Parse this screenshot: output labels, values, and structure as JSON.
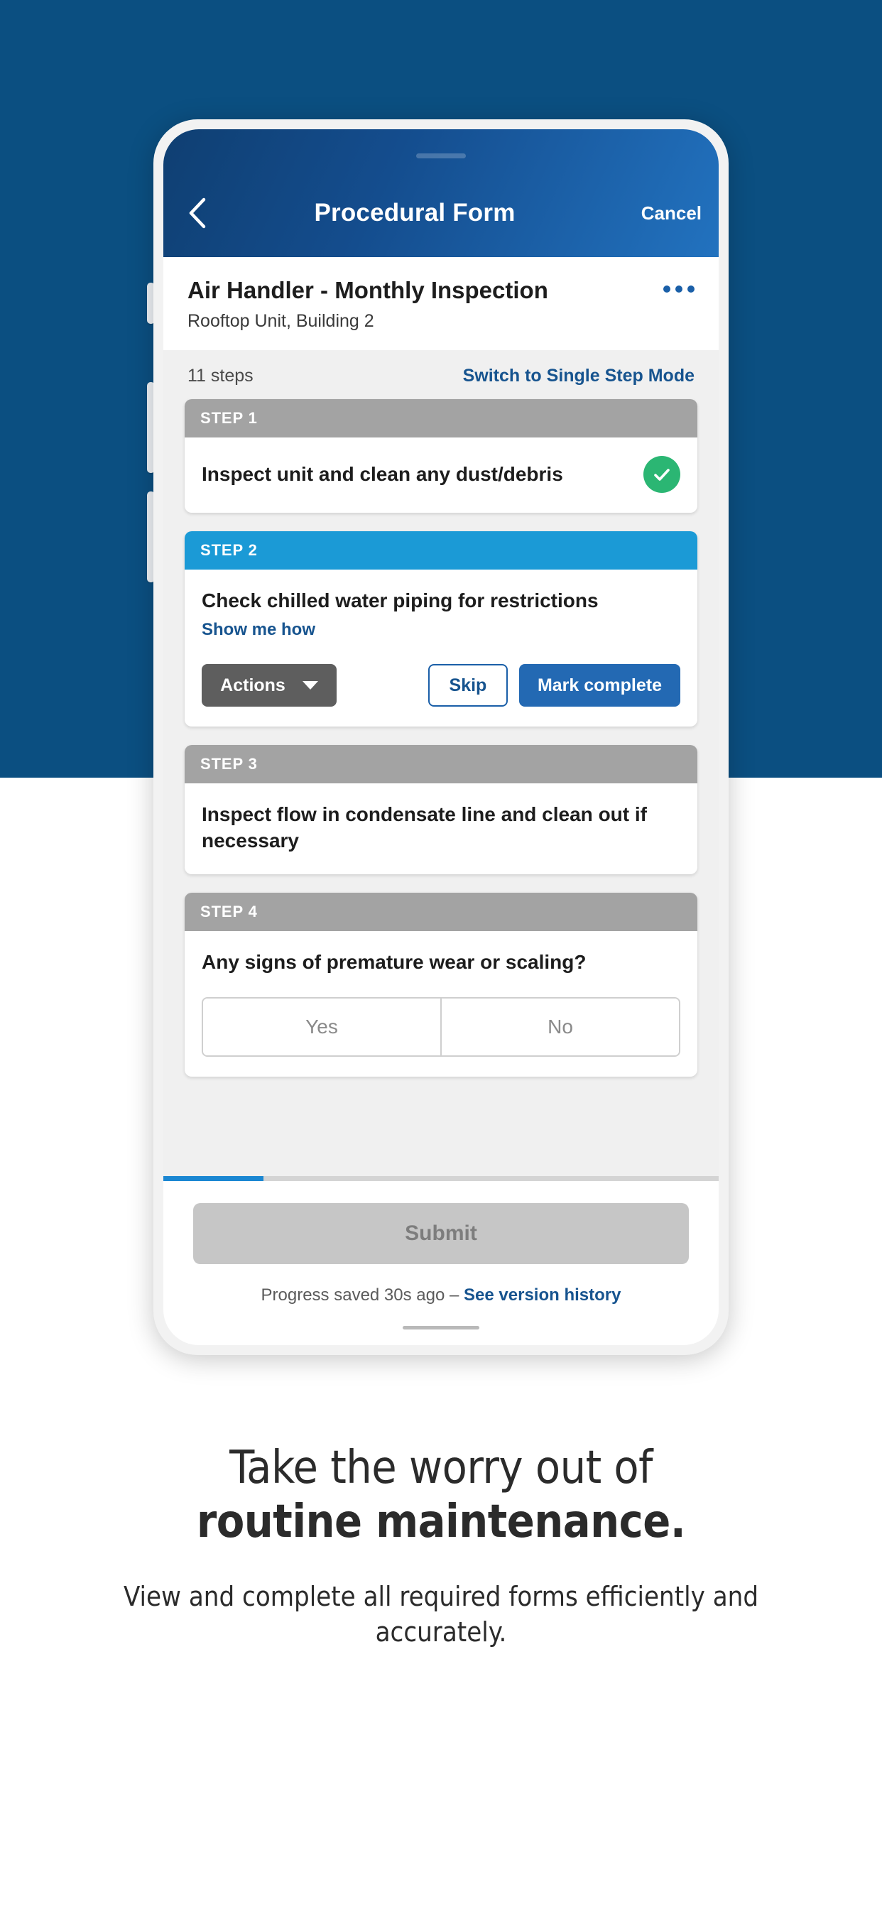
{
  "colors": {
    "backdrop_blue": "#0b4f81",
    "header_gradient_start": "#0f3f72",
    "header_gradient_end": "#2272bf",
    "active_step": "#1b9ad6",
    "inactive_step": "#a3a3a3",
    "link_blue": "#17548f",
    "primary_button": "#2369b3",
    "success_green": "#2bb673",
    "progress_fill": "#1b87d2"
  },
  "nav": {
    "back_icon": "chevron-left-icon",
    "title": "Procedural Form",
    "cancel_label": "Cancel"
  },
  "form": {
    "title": "Air Handler - Monthly Inspection",
    "subtitle": "Rooftop Unit, Building 2",
    "overflow_icon": "ellipsis-horizontal-icon"
  },
  "steps_bar": {
    "count_label": "11 steps",
    "switch_mode_label": "Switch to Single Step Mode"
  },
  "steps": [
    {
      "header": "STEP 1",
      "state": "complete",
      "text": "Inspect unit and clean any dust/debris",
      "check_icon": "check-circle-icon"
    },
    {
      "header": "STEP 2",
      "state": "active",
      "text": "Check chilled water piping for restrictions",
      "help_link": "Show me how",
      "actions_label": "Actions",
      "actions_caret_icon": "caret-down-icon",
      "skip_label": "Skip",
      "complete_label": "Mark complete"
    },
    {
      "header": "STEP 3",
      "state": "pending",
      "text": "Inspect flow in condensate line and clean out if necessary"
    },
    {
      "header": "STEP 4",
      "state": "pending",
      "text": "Any signs of premature wear or scaling?",
      "options": [
        "Yes",
        "No"
      ]
    }
  ],
  "footer": {
    "progress_percent": 18,
    "submit_label": "Submit",
    "saved_text": "Progress saved 30s ago – ",
    "version_link": "See version history"
  },
  "marketing": {
    "headline_line1": "Take the worry out of",
    "headline_line2": "routine maintenance.",
    "subhead": "View and complete all required forms efficiently and accurately."
  }
}
